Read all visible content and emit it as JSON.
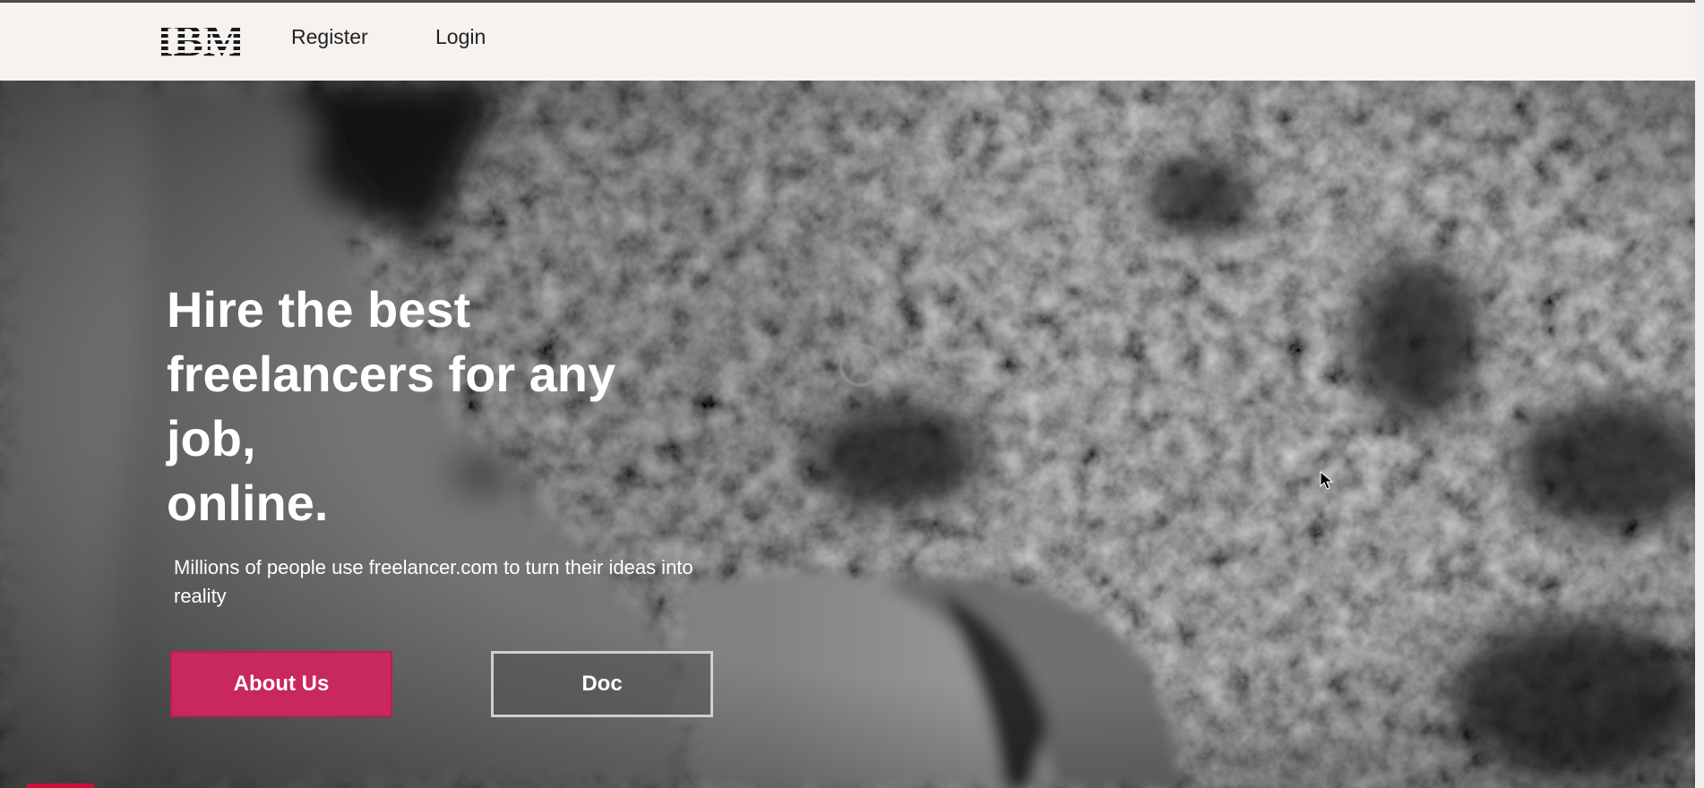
{
  "nav": {
    "logo_text": "IBM",
    "links": [
      {
        "label": "Register"
      },
      {
        "label": "Login"
      }
    ]
  },
  "hero": {
    "title_lines": [
      "Hire the best",
      "freelancers for any",
      "job,",
      "online."
    ],
    "subtitle": "Millions of people use freelancer.com to turn their ideas into reality",
    "buttons": {
      "about": "About Us",
      "doc": "Doc"
    },
    "replay_seconds": "5"
  },
  "icons": {
    "replay": "replay-5-seconds-icon",
    "cursor": "mouse-pointer-icon"
  },
  "colors": {
    "nav_bg": "#f5f2f0",
    "primary_button": "#c8285d",
    "hero_text": "#ffffff"
  }
}
